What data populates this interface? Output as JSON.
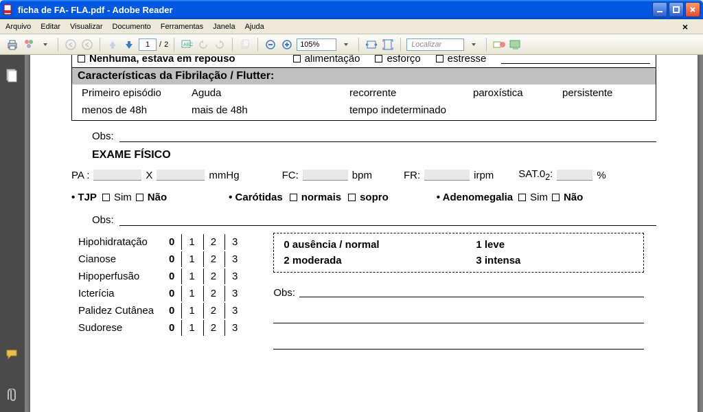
{
  "window": {
    "title": "ficha de FA- FLA.pdf - Adobe Reader"
  },
  "menu": {
    "items": [
      "Arquivo",
      "Editar",
      "Visualizar",
      "Documento",
      "Ferramentas",
      "Janela",
      "Ajuda"
    ],
    "close_label": "×"
  },
  "toolbar": {
    "page_current": "1",
    "page_sep": "/",
    "page_total": "2",
    "zoom": "105%",
    "find_placeholder": "Localizar"
  },
  "doc": {
    "top_row": {
      "opt1": "Nenhuma, estava em repouso",
      "opt2": "alimentação",
      "opt3": "esforço",
      "opt4": "estresse"
    },
    "sect_header": "Características da Fibrilação / Flutter:",
    "sect_opts": [
      "Primeiro episódio",
      "Aguda",
      "recorrente",
      "paroxística",
      "persistente",
      "menos de 48h",
      "mais de 48h",
      "tempo indeterminado"
    ],
    "obs_label": "Obs:",
    "ef_title": "EXAME FÍSICO",
    "vitals": {
      "pa": "PA :",
      "x": "X",
      "mmhg": "mmHg",
      "fc": "FC:",
      "bpm": "bpm",
      "fr": "FR:",
      "irpm": "irpm",
      "sat": "SAT.0",
      "sat_sub": "2",
      "sat_colon": ":",
      "pct": "%"
    },
    "row2": {
      "tjp": "• TJP",
      "sim": "Sim",
      "nao": "Não",
      "carotidas": "• Carótidas",
      "normais": "normais",
      "sopro": "sopro",
      "adeno": "• Adenomegalia"
    },
    "scale_items": [
      "Hipohidratação",
      "Cianose",
      "Hipoperfusão",
      "Icterícia",
      "Palidez Cutânea",
      "Sudorese"
    ],
    "scale_vals": [
      "0",
      "1",
      "2",
      "3"
    ],
    "legend": {
      "a": "0 ausência / normal",
      "b": "1 leve",
      "c": "2 moderada",
      "d": "3 intensa"
    }
  }
}
